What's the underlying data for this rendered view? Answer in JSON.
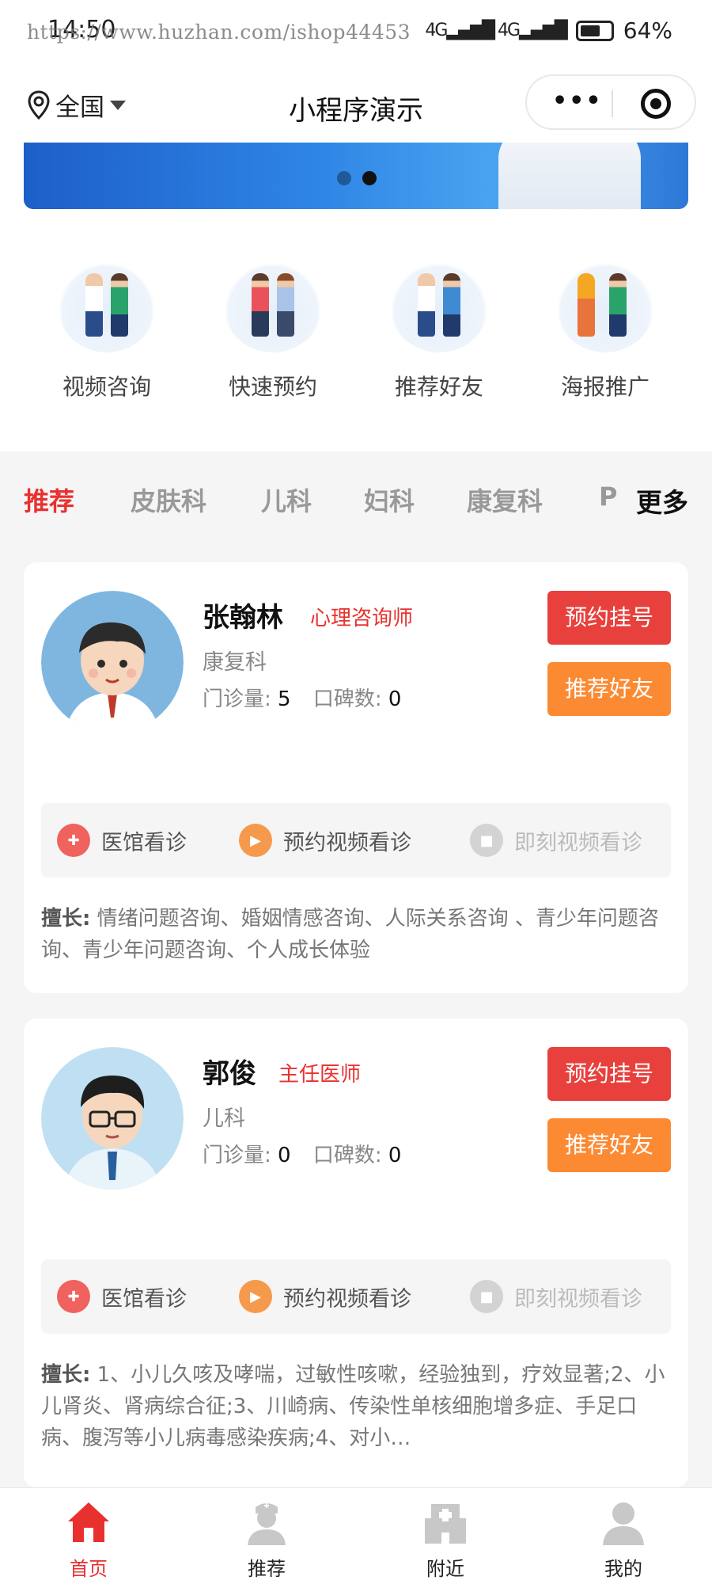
{
  "status_bar": {
    "time": "14:50",
    "watermark_url": "https://www.huzhan.com/ishop44453",
    "battery": "64%"
  },
  "nav": {
    "location": "全国",
    "title": "小程序演示"
  },
  "quick_actions": [
    {
      "label": "视频咨询",
      "icon": "video-consult-illustration"
    },
    {
      "label": "快速预约",
      "icon": "quick-booking-illustration"
    },
    {
      "label": "推荐好友",
      "icon": "recommend-friend-illustration"
    },
    {
      "label": "海报推广",
      "icon": "poster-promotion-illustration"
    }
  ],
  "tabs": {
    "items": [
      "推荐",
      "皮肤科",
      "儿科",
      "妇科",
      "康复科",
      "P"
    ],
    "active_index": 0,
    "more": "更多"
  },
  "doctors": [
    {
      "name": "张翰林",
      "title": "心理咨询师",
      "department": "康复科",
      "visits_label": "门诊量:",
      "visits": "5",
      "reviews_label": "口碑数:",
      "reviews": "0",
      "book_label": "预约挂号",
      "recommend_label": "推荐好友",
      "services": [
        "医馆看诊",
        "预约视频看诊",
        "即刻视频看诊"
      ],
      "specialty_label": "擅长:",
      "specialty": "情绪问题咨询、婚姻情感咨询、人际关系咨询 、青少年问题咨询、青少年问题咨询、个人成长体验"
    },
    {
      "name": "郭俊",
      "title": "主任医师",
      "department": "儿科",
      "visits_label": "门诊量:",
      "visits": "0",
      "reviews_label": "口碑数:",
      "reviews": "0",
      "book_label": "预约挂号",
      "recommend_label": "推荐好友",
      "services": [
        "医馆看诊",
        "预约视频看诊",
        "即刻视频看诊"
      ],
      "specialty_label": "擅长:",
      "specialty": "1、小儿久咳及哮喘，过敏性咳嗽，经验独到，疗效显著;2、小儿肾炎、肾病综合征;3、川崎病、传染性单核细胞增多症、手足口病、腹泻等小儿病毒感染疾病;4、对小…"
    }
  ],
  "bottom_nav": [
    {
      "label": "首页",
      "icon": "home-icon"
    },
    {
      "label": "推荐",
      "icon": "doctor-icon"
    },
    {
      "label": "附近",
      "icon": "hospital-icon"
    },
    {
      "label": "我的",
      "icon": "user-icon"
    }
  ],
  "colors": {
    "accent_red": "#e8312f",
    "book_button": "#e8403c",
    "recommend_button": "#fb8a33",
    "inactive_gray": "#c8c8c8"
  }
}
